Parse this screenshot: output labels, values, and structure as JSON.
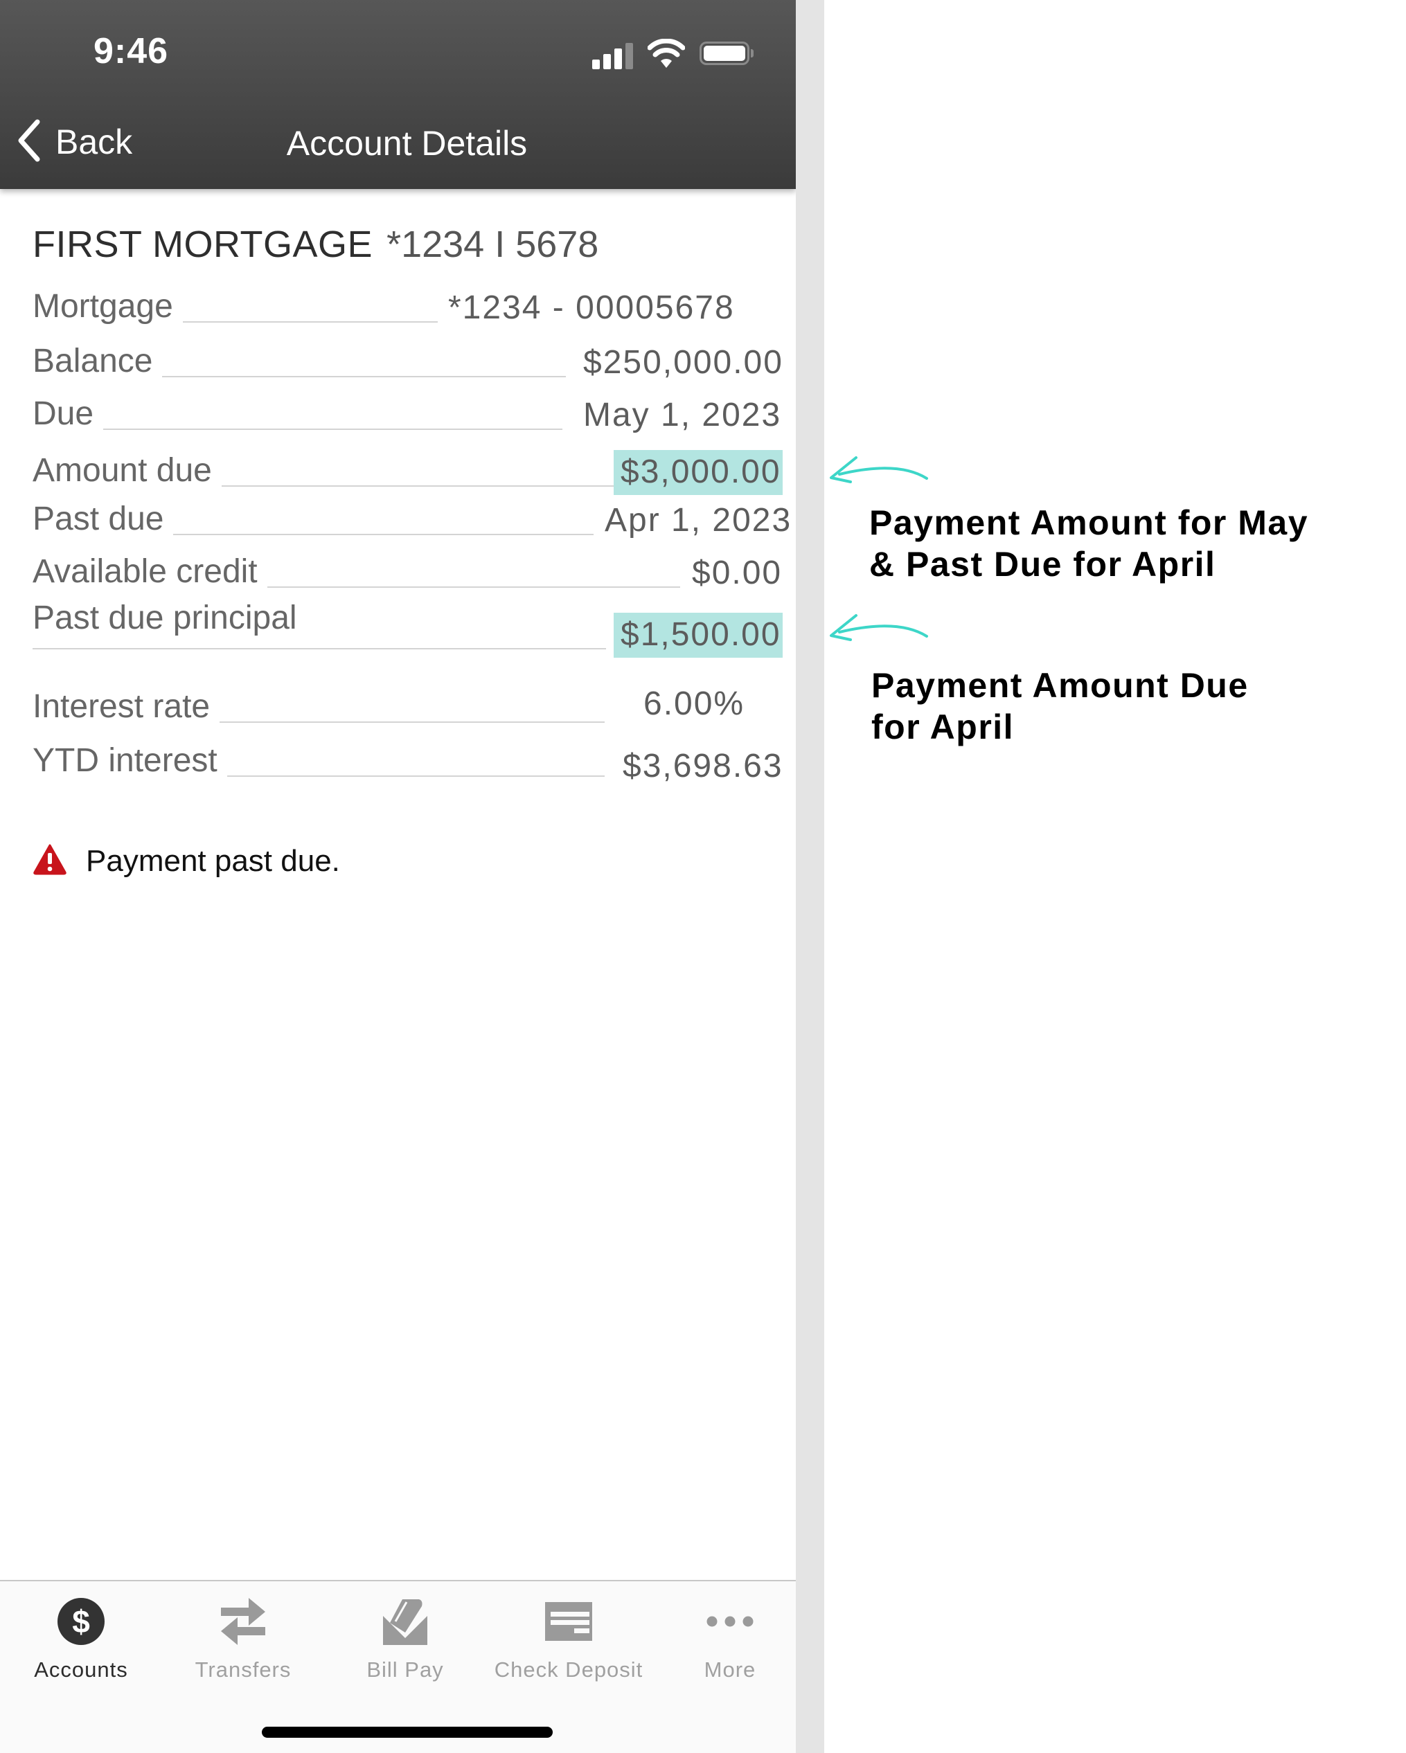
{
  "status_bar": {
    "time": "9:46",
    "icons": [
      "cellular-signal-icon",
      "wifi-icon",
      "battery-icon"
    ]
  },
  "nav": {
    "back_label": "Back",
    "title": "Account Details"
  },
  "account": {
    "name": "FIRST MORTGAGE",
    "number": "*1234 I 5678"
  },
  "details": [
    {
      "label": "Mortgage",
      "value": "*1234 - 00005678",
      "highlighted": false
    },
    {
      "label": "Balance",
      "value": "$250,000.00",
      "highlighted": false
    },
    {
      "label": "Due",
      "value": "May 1, 2023",
      "highlighted": false
    },
    {
      "label": "Amount due",
      "value": "$3,000.00",
      "highlighted": true
    },
    {
      "label": "Past due",
      "value": "Apr 1, 2023",
      "highlighted": false
    },
    {
      "label": "Available credit",
      "value": "$0.00",
      "highlighted": false
    },
    {
      "label": "Past due principal",
      "value": "$1,500.00",
      "highlighted": true
    },
    {
      "label": "Interest rate",
      "value": "6.00%",
      "highlighted": false
    },
    {
      "label": "YTD interest",
      "value": "$3,698.63",
      "highlighted": false
    }
  ],
  "warning": {
    "icon": "warning-triangle-icon",
    "text": "Payment past due."
  },
  "tabbar": {
    "items": [
      {
        "label": "Accounts",
        "icon": "dollar-circle-icon",
        "active": true
      },
      {
        "label": "Transfers",
        "icon": "transfer-arrows-icon",
        "active": false
      },
      {
        "label": "Bill Pay",
        "icon": "envelope-bill-icon",
        "active": false
      },
      {
        "label": "Check Deposit",
        "icon": "check-icon",
        "active": false
      },
      {
        "label": "More",
        "icon": "more-dots-icon",
        "active": false
      }
    ]
  },
  "annotations": [
    {
      "text_line1": "Payment Amount for May",
      "text_line2": "& Past Due for April",
      "points_to": "Amount due"
    },
    {
      "text_line1": "Payment Amount Due",
      "text_line2": "for April",
      "points_to": "Past due principal"
    }
  ],
  "colors": {
    "header_top": "#575757",
    "header_bottom": "#3b3b3b",
    "highlight": "#b3e5e1",
    "annotation_arrow": "#3dd6c8",
    "warning_red": "#c8141c",
    "tab_active": "#2c2c2c",
    "tab_inactive": "#a0a0a0"
  }
}
